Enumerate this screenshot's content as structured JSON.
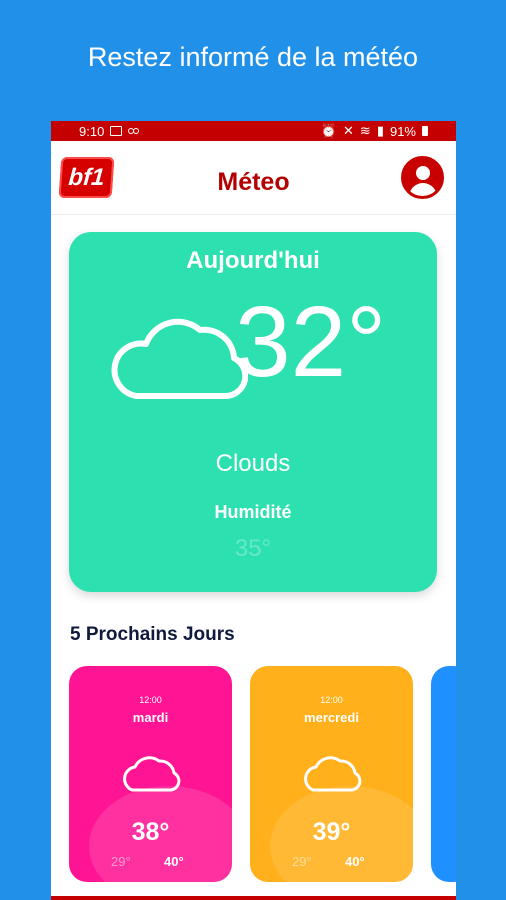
{
  "promo": {
    "text": "Restez informé de la météo"
  },
  "status": {
    "time": "9:10",
    "battery": "91%"
  },
  "header": {
    "logo": "bf1",
    "title": "Méteo"
  },
  "today": {
    "label": "Aujourd'hui",
    "temperature": "32°",
    "condition": "Clouds",
    "humidity_label": "Humidité",
    "humidity_value": "35°"
  },
  "forecast": {
    "title": "5 Prochains Jours",
    "days": [
      {
        "time": "12:00",
        "day": "mardi",
        "temp": "38°",
        "min": "29°",
        "max": "40°",
        "color": "#ff1493"
      },
      {
        "time": "12:00",
        "day": "mercredi",
        "temp": "39°",
        "min": "29°",
        "max": "40°",
        "color": "#ffb01a"
      }
    ],
    "third_card_color": "#1e90ff"
  },
  "colors": {
    "background": "#2190e8",
    "accent_red": "#c40000",
    "today_card": "#2de0b0"
  }
}
